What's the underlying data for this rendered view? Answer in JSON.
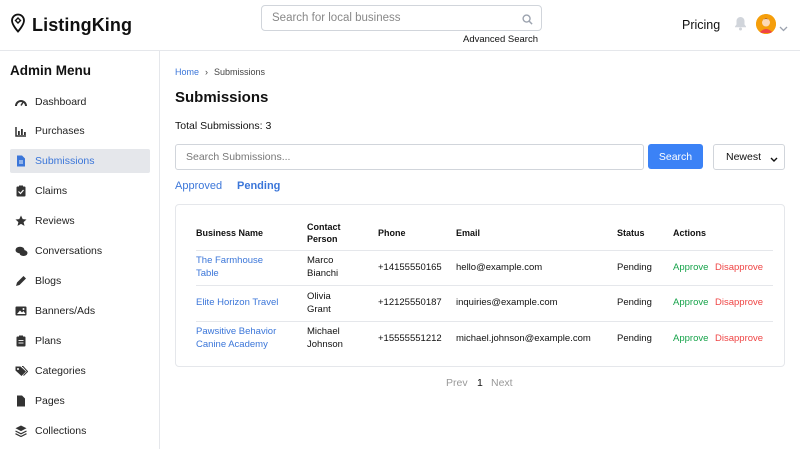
{
  "header": {
    "brand": "ListingKing",
    "search_placeholder": "Search for local business",
    "advanced_search": "Advanced Search",
    "pricing": "Pricing"
  },
  "sidebar": {
    "title": "Admin Menu",
    "items": [
      {
        "label": "Dashboard",
        "icon": "dashboard-icon",
        "active": false
      },
      {
        "label": "Purchases",
        "icon": "chart-icon",
        "active": false
      },
      {
        "label": "Submissions",
        "icon": "file-icon",
        "active": true
      },
      {
        "label": "Claims",
        "icon": "clipboard-check-icon",
        "active": false
      },
      {
        "label": "Reviews",
        "icon": "star-icon",
        "active": false
      },
      {
        "label": "Conversations",
        "icon": "comments-icon",
        "active": false
      },
      {
        "label": "Blogs",
        "icon": "pen-icon",
        "active": false
      },
      {
        "label": "Banners/Ads",
        "icon": "image-icon",
        "active": false
      },
      {
        "label": "Plans",
        "icon": "clipboard-list-icon",
        "active": false
      },
      {
        "label": "Categories",
        "icon": "tags-icon",
        "active": false
      },
      {
        "label": "Pages",
        "icon": "page-icon",
        "active": false
      },
      {
        "label": "Collections",
        "icon": "layers-icon",
        "active": false
      }
    ]
  },
  "main": {
    "breadcrumb": {
      "home": "Home",
      "sep": "›",
      "current": "Submissions"
    },
    "title": "Submissions",
    "total": "Total Submissions: 3",
    "search_placeholder": "Search Submissions...",
    "search_button": "Search",
    "sort": "Newest",
    "tabs": [
      {
        "label": "Approved",
        "active": false
      },
      {
        "label": "Pending",
        "active": true
      }
    ],
    "table": {
      "headers": {
        "business": "Business Name",
        "contact_1": "Contact",
        "contact_2": "Person",
        "phone": "Phone",
        "email": "Email",
        "status": "Status",
        "actions": "Actions"
      },
      "rows": [
        {
          "biz_1": "The Farmhouse",
          "biz_2": "Table",
          "contact_1": "Marco",
          "contact_2": "Bianchi",
          "phone": "+14155550165",
          "email": "hello@example.com",
          "status": "Pending",
          "approve": "Approve",
          "disapprove": "Disapprove"
        },
        {
          "biz_1": "Elite Horizon Travel",
          "biz_2": "",
          "contact_1": "Olivia",
          "contact_2": "Grant",
          "phone": "+12125550187",
          "email": "inquiries@example.com",
          "status": "Pending",
          "approve": "Approve",
          "disapprove": "Disapprove"
        },
        {
          "biz_1": "Pawsitive Behavior",
          "biz_2": "Canine Academy",
          "contact_1": "Michael",
          "contact_2": "Johnson",
          "phone": "+15555551212",
          "email": "michael.johnson@example.com",
          "status": "Pending",
          "approve": "Approve",
          "disapprove": "Disapprove"
        }
      ]
    },
    "pagination": {
      "prev": "Prev",
      "current": "1",
      "next": "Next"
    }
  },
  "colors": {
    "accent": "#3b82f6",
    "link": "#3b76d9",
    "approve": "#16a34a",
    "disapprove": "#ef4444"
  }
}
